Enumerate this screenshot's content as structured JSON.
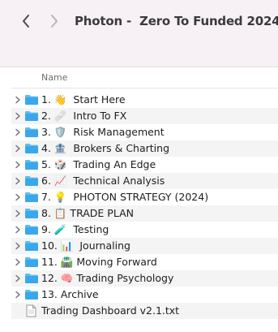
{
  "window": {
    "title": "Photon -  Zero To Funded 2024"
  },
  "column": {
    "name_header": "Name"
  },
  "items": [
    {
      "label": "1. 👋  Start Here",
      "kind": "folder"
    },
    {
      "label": "2. 🩹  Intro To FX",
      "kind": "folder"
    },
    {
      "label": "3. 🛡️  Risk Management",
      "kind": "folder"
    },
    {
      "label": "4. 🏦  Brokers & Charting",
      "kind": "folder"
    },
    {
      "label": "5. 🎲  Trading An Edge",
      "kind": "folder"
    },
    {
      "label": "6. 📈  Technical Analysis",
      "kind": "folder"
    },
    {
      "label": "7. 💡  PHOTON STRATEGY (2024)",
      "kind": "folder"
    },
    {
      "label": "8. 📋 TRADE PLAN",
      "kind": "folder"
    },
    {
      "label": "9. 🧪  Testing",
      "kind": "folder"
    },
    {
      "label": "10. 📊  Journaling",
      "kind": "folder"
    },
    {
      "label": "11. 🛣️ Moving Forward",
      "kind": "folder"
    },
    {
      "label": "12. 🧠 Trading Psychology",
      "kind": "folder"
    },
    {
      "label": "13. Archive",
      "kind": "folder"
    },
    {
      "label": "Trading Dashboard v2.1.txt",
      "kind": "file"
    }
  ],
  "colors": {
    "folder": "#3aa7ec",
    "folder_tab": "#5cbcf4",
    "toolbar_bg": "#f7f0f5"
  }
}
